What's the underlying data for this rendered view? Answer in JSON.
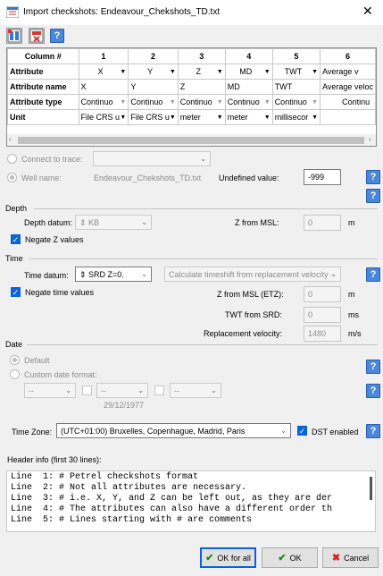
{
  "window": {
    "title": "Import checkshots: Endeavour_Chekshots_TD.txt"
  },
  "toolbar": {
    "help_label": "?"
  },
  "grid": {
    "corner": "Column #",
    "columns": [
      "1",
      "2",
      "3",
      "4",
      "5",
      "6"
    ],
    "rows": [
      {
        "label": "Attribute",
        "cells": [
          "X",
          "Y",
          "Z",
          "MD",
          "TWT",
          "Average v"
        ]
      },
      {
        "label": "Attribute name",
        "cells": [
          "X",
          "Y",
          "Z",
          "MD",
          "TWT",
          "Average veloc"
        ]
      },
      {
        "label": "Attribute type",
        "cells": [
          "Continuo",
          "Continuo",
          "Continuo",
          "Continuo",
          "Continuo",
          "Continu"
        ]
      },
      {
        "label": "Unit",
        "cells": [
          "File CRS u",
          "File CRS u",
          "meter",
          "meter",
          "millisecor",
          ""
        ]
      }
    ]
  },
  "trace": {
    "connect_label": "Connect to trace:",
    "well_name_label": "Well name:",
    "well_name_value": "Endeavour_Chekshots_TD.txt",
    "undefined_label": "Undefined value:",
    "undefined_value": "-999"
  },
  "depth": {
    "section": "Depth",
    "datum_label": "Depth datum:",
    "datum_value": "KB",
    "z_msl_label": "Z from MSL:",
    "z_msl_value": "0",
    "z_msl_unit": "m",
    "negate_label": "Negate Z values"
  },
  "time": {
    "section": "Time",
    "datum_label": "Time datum:",
    "datum_value": "SRD Z=0.",
    "shift_option": "Calculate timeshift from replacement velocity",
    "negate_label": "Negate time values",
    "z_msl_etz_label": "Z from MSL (ETZ):",
    "z_msl_etz_value": "0",
    "z_msl_etz_unit": "m",
    "twt_srd_label": "TWT from SRD:",
    "twt_srd_value": "0",
    "twt_srd_unit": "ms",
    "rep_vel_label": "Replacement velocity:",
    "rep_vel_value": "1480",
    "rep_vel_unit": "m/s"
  },
  "date": {
    "section": "Date",
    "default_label": "Default",
    "custom_label": "Custom date format:",
    "combo1": "--",
    "combo2": "--",
    "combo3": "--",
    "example": "29/12/1977"
  },
  "timezone": {
    "label": "Time Zone:",
    "value": "(UTC+01:00) Bruxelles, Copenhague, Madrid, Paris",
    "dst_label": "DST enabled"
  },
  "header_info": {
    "label": "Header info (first 30 lines):",
    "lines": [
      "Line  1: # Petrel checkshots format",
      "Line  2: # Not all attributes are necessary.",
      "Line  3: # i.e. X, Y, and Z can be left out, as they are der",
      "Line  4: # The attributes can also have a different order th",
      "Line  5: # Lines starting with # are comments"
    ]
  },
  "buttons": {
    "ok_all": "OK for all",
    "ok": "OK",
    "cancel": "Cancel"
  },
  "colors": {
    "accent": "#0a64d8",
    "help_blue": "#4b86d8"
  }
}
